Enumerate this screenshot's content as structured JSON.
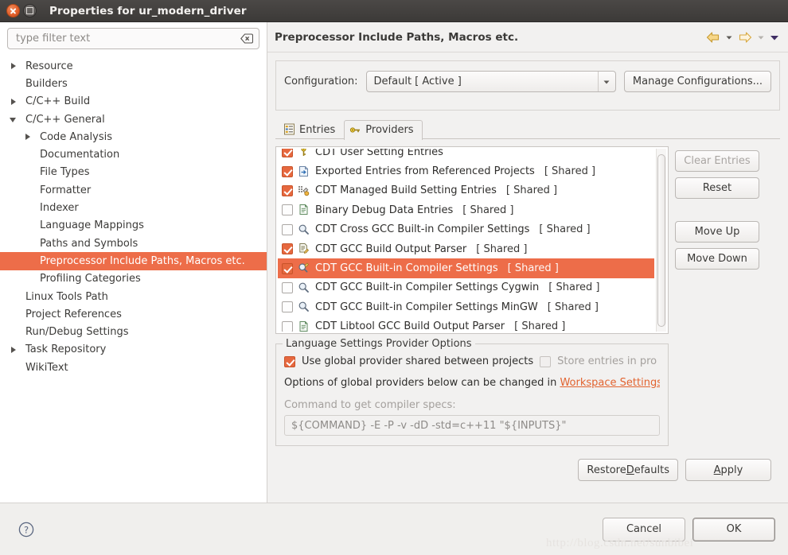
{
  "window": {
    "title": "Properties for ur_modern_driver",
    "close_label": "Close",
    "maximize_label": "Maximize"
  },
  "sidebar": {
    "filter": {
      "placeholder": "type filter text",
      "value": "",
      "clear_icon": "clear-icon"
    },
    "items": [
      {
        "label": "Resource",
        "indent": 0,
        "twisty": "collapsed",
        "selected": false
      },
      {
        "label": "Builders",
        "indent": 0,
        "twisty": "none",
        "selected": false
      },
      {
        "label": "C/C++ Build",
        "indent": 0,
        "twisty": "collapsed",
        "selected": false
      },
      {
        "label": "C/C++ General",
        "indent": 0,
        "twisty": "expanded",
        "selected": false
      },
      {
        "label": "Code Analysis",
        "indent": 1,
        "twisty": "collapsed",
        "selected": false
      },
      {
        "label": "Documentation",
        "indent": 1,
        "twisty": "none",
        "selected": false
      },
      {
        "label": "File Types",
        "indent": 1,
        "twisty": "none",
        "selected": false
      },
      {
        "label": "Formatter",
        "indent": 1,
        "twisty": "none",
        "selected": false
      },
      {
        "label": "Indexer",
        "indent": 1,
        "twisty": "none",
        "selected": false
      },
      {
        "label": "Language Mappings",
        "indent": 1,
        "twisty": "none",
        "selected": false
      },
      {
        "label": "Paths and Symbols",
        "indent": 1,
        "twisty": "none",
        "selected": false
      },
      {
        "label": "Preprocessor Include Paths, Macros etc.",
        "indent": 1,
        "twisty": "none",
        "selected": true
      },
      {
        "label": "Profiling Categories",
        "indent": 1,
        "twisty": "none",
        "selected": false
      },
      {
        "label": "Linux Tools Path",
        "indent": 0,
        "twisty": "none",
        "selected": false
      },
      {
        "label": "Project References",
        "indent": 0,
        "twisty": "none",
        "selected": false
      },
      {
        "label": "Run/Debug Settings",
        "indent": 0,
        "twisty": "none",
        "selected": false
      },
      {
        "label": "Task Repository",
        "indent": 0,
        "twisty": "collapsed",
        "selected": false
      },
      {
        "label": "WikiText",
        "indent": 0,
        "twisty": "none",
        "selected": false
      }
    ]
  },
  "page": {
    "title": "Preprocessor Include Paths, Macros etc.",
    "nav": {
      "back_icon": "back-arrow-icon",
      "back_menu_icon": "chevron-down-icon",
      "forward_icon": "forward-arrow-icon",
      "forward_menu_icon": "chevron-down-icon",
      "overflow_icon": "chevron-down-icon"
    },
    "configuration": {
      "label": "Configuration:",
      "selected": "Default  [ Active ]",
      "dropdown_icon": "chevron-down-icon",
      "manage_button": "Manage Configurations..."
    },
    "tabs": [
      {
        "label": "Entries",
        "icon": "entries-icon",
        "active": false
      },
      {
        "label": "Providers",
        "icon": "key-icon",
        "active": true
      }
    ],
    "providers": [
      {
        "label": "CDT User Setting Entries",
        "shared": "",
        "checked": true,
        "icon": "key-icon",
        "selected": false
      },
      {
        "label": "Exported Entries from Referenced Projects",
        "shared": "[ Shared ]",
        "checked": true,
        "icon": "export-icon",
        "selected": false
      },
      {
        "label": "CDT Managed Build Setting Entries",
        "shared": "[ Shared ]",
        "checked": true,
        "icon": "build-icon",
        "selected": false
      },
      {
        "label": "Binary Debug Data Entries",
        "shared": "[ Shared ]",
        "checked": false,
        "icon": "document-icon",
        "selected": false
      },
      {
        "label": "CDT Cross GCC Built-in Compiler Settings",
        "shared": "[ Shared ]",
        "checked": false,
        "icon": "magnifier-icon",
        "selected": false
      },
      {
        "label": "CDT GCC Build Output Parser",
        "shared": "[ Shared ]",
        "checked": true,
        "icon": "parser-icon",
        "selected": false
      },
      {
        "label": "CDT GCC Built-in Compiler Settings",
        "shared": "[ Shared ]",
        "checked": true,
        "icon": "magnifier-pen-icon",
        "selected": true
      },
      {
        "label": "CDT GCC Built-in Compiler Settings Cygwin",
        "shared": "[ Shared ]",
        "checked": false,
        "icon": "magnifier-icon",
        "selected": false
      },
      {
        "label": "CDT GCC Built-in Compiler Settings MinGW",
        "shared": "[ Shared ]",
        "checked": false,
        "icon": "magnifier-icon",
        "selected": false
      },
      {
        "label": "CDT Libtool GCC Build Output Parser",
        "shared": "[ Shared ]",
        "checked": false,
        "icon": "document-icon",
        "selected": false
      }
    ],
    "side_buttons": {
      "clear_entries": "Clear Entries",
      "reset": "Reset",
      "move_up": "Move Up",
      "move_down": "Move Down"
    },
    "options": {
      "legend": "Language Settings Provider Options",
      "use_global_label": "Use global provider shared between projects",
      "use_global_checked": true,
      "store_entries_label": "Store entries in pro",
      "store_entries_checked": false,
      "hint_prefix": "Options of global providers below can be changed in ",
      "hint_link": "Workspace Settings",
      "command_label": "Command to get compiler specs:",
      "command_value": "${COMMAND} -E -P -v -dD -std=c++11 \"${INPUTS}\""
    },
    "footer": {
      "restore_defaults_pre": "Restore ",
      "restore_defaults_mn": "D",
      "restore_defaults_post": "efaults",
      "apply_mn": "A",
      "apply_post": "pply"
    }
  },
  "bottom": {
    "help_icon": "help-icon",
    "cancel": "Cancel",
    "ok": "OK",
    "watermark": "http://blog.csdn.net/sunbibei"
  },
  "colors": {
    "selection": "#ed6d49",
    "checkbox_checked": "#e6683f",
    "link": "#e2632f",
    "titlebar": "#413e3c",
    "panel_bg": "#f2f1f0"
  }
}
